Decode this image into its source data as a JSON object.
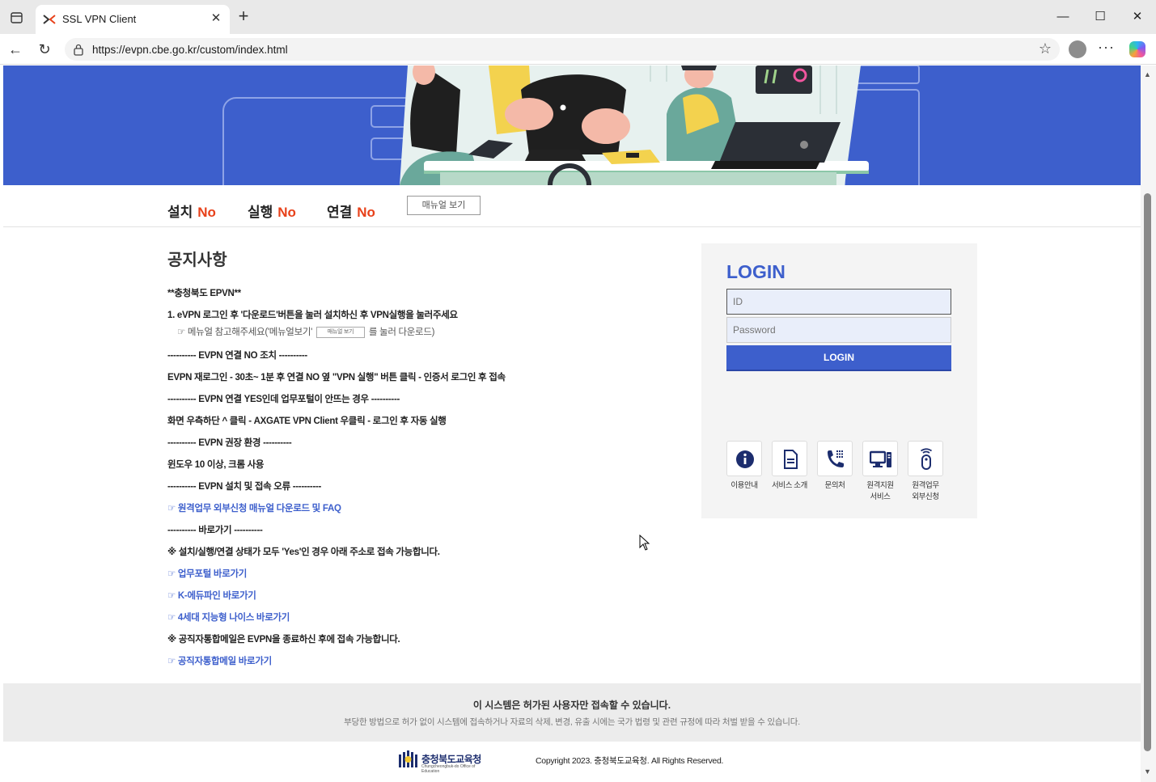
{
  "browser": {
    "tab_title": "SSL VPN Client",
    "url": "https://evpn.cbe.go.kr/custom/index.html",
    "window_controls": [
      "minimize",
      "maximize",
      "close"
    ]
  },
  "status": {
    "install_label": "설치",
    "install_value": "No",
    "run_label": "실행",
    "run_value": "No",
    "connect_label": "연결",
    "connect_value": "No",
    "manual_button": "매뉴얼 보기"
  },
  "notice": {
    "title": "공지사항",
    "lines": [
      "**충청북도 EPVN**",
      "1. eVPN 로그인 후 '다운로드'버튼을 눌러 설치하신 후 VPN실행을 눌러주세요",
      "---------- EVPN 연결 NO 조치 ----------",
      "EVPN 재로그인 - 30초~ 1분 후 연결 NO 옆 \"VPN 실행\" 버튼 클릭 - 인증서 로그인 후 접속",
      "---------- EVPN 연결 YES인데 업무포털이 안뜨는 경우 ----------",
      "화면 우측하단 ^ 클릭 - AXGATE VPN Client 우클릭 - 로그인 후 자동 실행",
      "---------- EVPN 권장 환경 ----------",
      "윈도우 10 이상, 크롬 사용",
      "---------- EVPN 설치 및 접속 오류 ----------",
      "---------- 바로가기 ----------",
      "※ 설치/실행/연결 상태가 모두 'Yes'인 경우 아래 주소로 접속 가능합니다.",
      "※ 공직자통합메일은 EVPN을 종료하신 후에 접속 가능합니다."
    ],
    "manual_hint_prefix": "☞ 메뉴얼 참고해주세요('메뉴얼보기'",
    "manual_hint_button": "매뉴얼 보기",
    "manual_hint_suffix": "를 눌러 다운로드)",
    "links": {
      "faq": "☞ 원격업무 외부신청 매뉴얼 다운로드 및 FAQ",
      "portal": "☞ 업무포털 바로가기",
      "edufine": "☞ K-에듀파인 바로가기",
      "neis": "☞ 4세대 지능형 나이스 바로가기",
      "mail": "☞ 공직자통합메일 바로가기"
    }
  },
  "login": {
    "title": "LOGIN",
    "id_placeholder": "ID",
    "password_placeholder": "Password",
    "button": "LOGIN"
  },
  "services": [
    {
      "label1": "이용안내",
      "label2": "",
      "icon": "info-icon"
    },
    {
      "label1": "서비스 소개",
      "label2": "",
      "icon": "document-icon"
    },
    {
      "label1": "문의처",
      "label2": "",
      "icon": "phone-icon"
    },
    {
      "label1": "원격지원",
      "label2": "서비스",
      "icon": "computer-icon"
    },
    {
      "label1": "원격업무",
      "label2": "외부신청",
      "icon": "remote-icon"
    }
  ],
  "footer": {
    "warning_title": "이 시스템은 허가된 사용자만 접속할 수 있습니다.",
    "warning_text": "부당한 방법으로 허가 없이 시스템에 접속하거나 자료의 삭제, 변경, 유출 시에는 국가 법령 및 관련 규정에 따라 처벌 받을 수 있습니다.",
    "org_name": "충청북도교육청",
    "org_sub": "Chungcheongbuk-do Office of Education",
    "copyright": "Copyright 2023. 충청북도교육청. All Rights Reserved."
  },
  "colors": {
    "accent": "#3d5fcc",
    "status_no": "#e8411a"
  }
}
